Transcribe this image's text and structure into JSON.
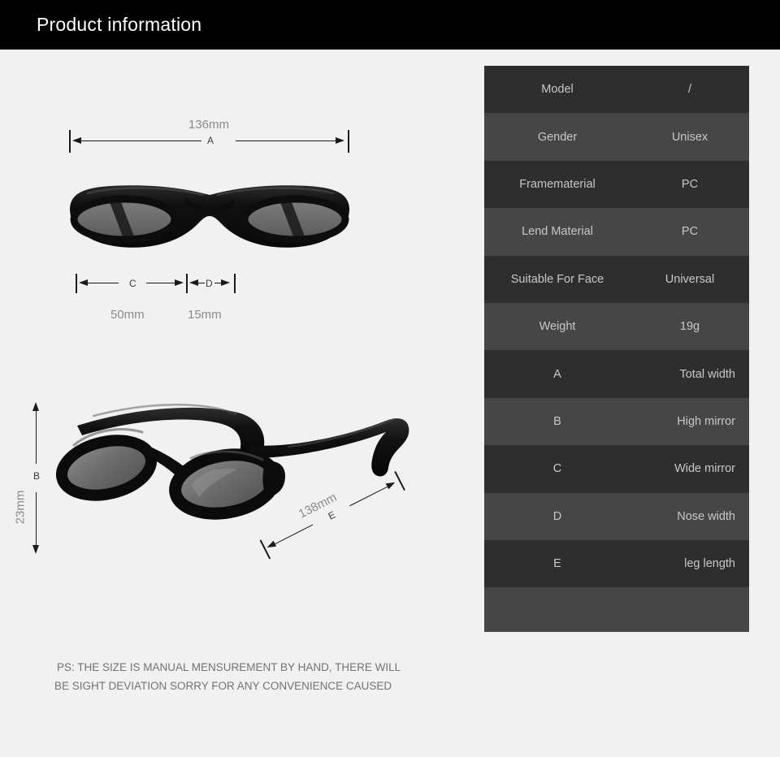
{
  "header": {
    "title": "Product information"
  },
  "dimensions": {
    "total_width": {
      "value": "136mm",
      "letter": "A"
    },
    "lens_width": {
      "value": "50mm",
      "letter": "C"
    },
    "nose_width": {
      "value": "15mm",
      "letter": "D"
    },
    "lens_height": {
      "value": "23mm",
      "letter": "B"
    },
    "temple_length": {
      "value": "138mm",
      "letter": "E"
    }
  },
  "footnote": {
    "line1": "PS:  THE SIZE IS MANUAL MENSUREMENT BY HAND, THERE WILL",
    "line2": "BE SIGHT DEVIATION SORRY FOR ANY CONVENIENCE CAUSED"
  },
  "spec_table": {
    "rows": [
      {
        "label": "Model",
        "value": "/",
        "align": "center"
      },
      {
        "label": "Gender",
        "value": "Unisex",
        "align": "center"
      },
      {
        "label": "Framematerial",
        "value": "PC",
        "align": "center"
      },
      {
        "label": "Lend Material",
        "value": "PC",
        "align": "center"
      },
      {
        "label": "Suitable For Face",
        "value": "Universal",
        "align": "center"
      },
      {
        "label": "Weight",
        "value": "19g",
        "align": "center"
      },
      {
        "label": "A",
        "value": "Total width",
        "align": "right"
      },
      {
        "label": "B",
        "value": "High mirror",
        "align": "right"
      },
      {
        "label": "C",
        "value": "Wide mirror",
        "align": "right"
      },
      {
        "label": "D",
        "value": "Nose width",
        "align": "right"
      },
      {
        "label": "E",
        "value": "leg length",
        "align": "right"
      },
      {
        "label": "",
        "value": "",
        "align": "center"
      }
    ]
  },
  "colors": {
    "page_background": "#f1f1f1",
    "header_background": "#000000",
    "header_text": "#ffffff",
    "row_dark": "#2e2e2e",
    "row_light": "#464646",
    "row_text": "#c8c8c8",
    "dimension_text": "#8a8a8a",
    "frame_black": "#121212",
    "lens_gray": "#6e6e6e"
  }
}
